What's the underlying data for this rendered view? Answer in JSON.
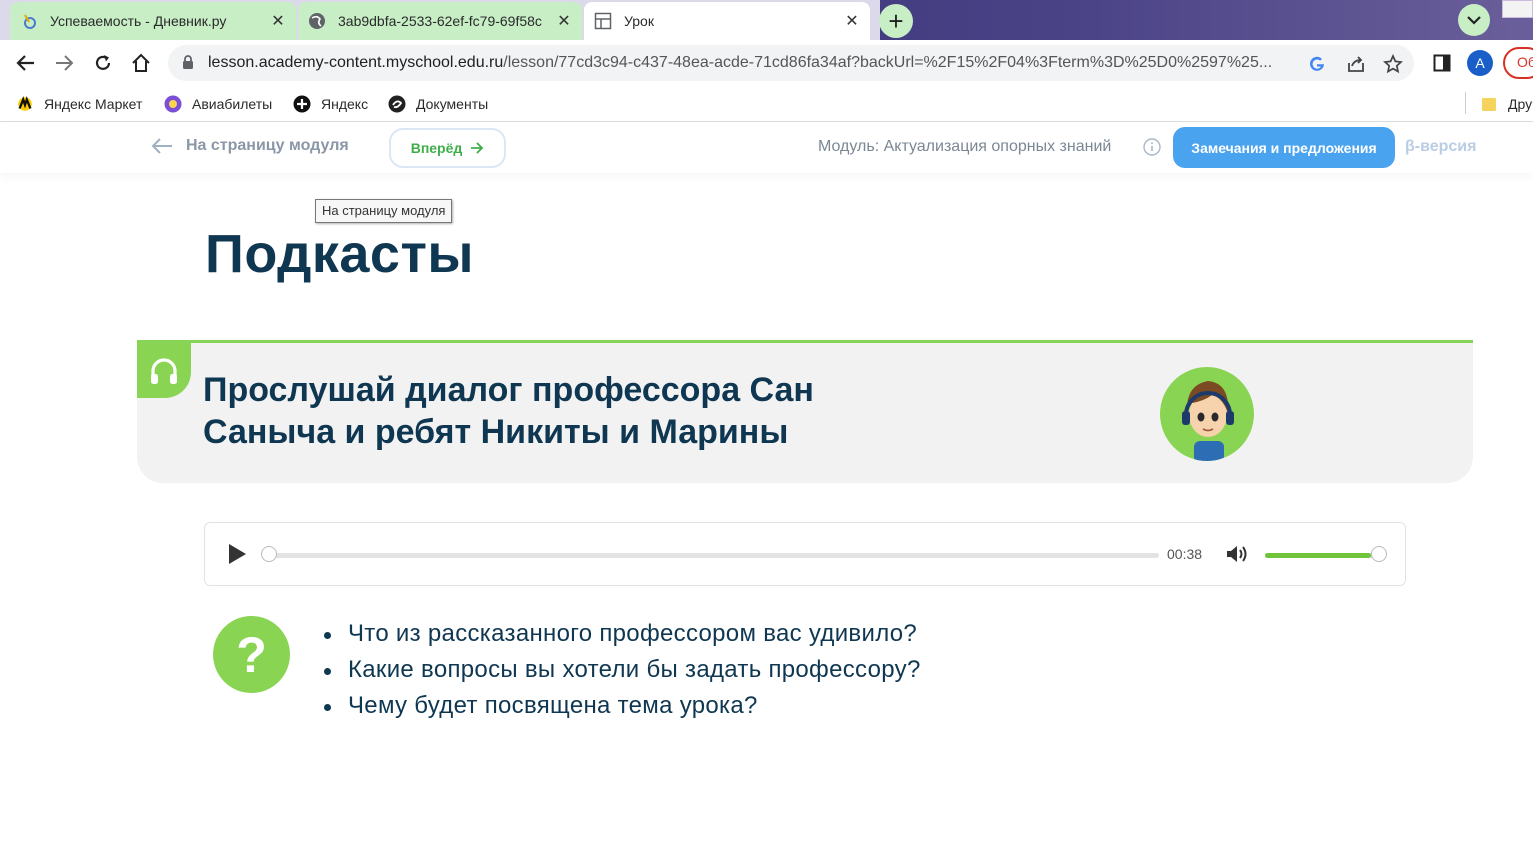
{
  "browser": {
    "tabs": [
      {
        "title": "Успеваемость - Дневник.ру",
        "icon": "dnevnik-favicon-icon",
        "state": "inactive"
      },
      {
        "title": "3ab9dbfa-2533-62ef-fc79-69f58c",
        "icon": "globe-icon",
        "state": "inactive"
      },
      {
        "title": "Урок",
        "icon": "page-layout-icon",
        "state": "active"
      }
    ],
    "url_host": "lesson.academy-content.myschool.edu.ru",
    "url_path": "/lesson/77cd3c94-c437-48ea-acde-71cd86fa34af?backUrl=%2F15%2F04%3Fterm%3D%25D0%2597%25...",
    "avatar_letter": "A",
    "profile_pill": "Об",
    "bookmarks": [
      {
        "label": "Яндекс Маркет",
        "icon": "yandex-market-icon"
      },
      {
        "label": "Авиабилеты",
        "icon": "flights-icon"
      },
      {
        "label": "Яндекс",
        "icon": "yandex-icon"
      },
      {
        "label": "Документы",
        "icon": "documents-icon"
      }
    ],
    "other_bookmarks": "Дру"
  },
  "lesson_nav": {
    "back_label": "На страницу модуля",
    "forward_label": "Вперёд",
    "module_label": "Модуль: Актуализация опорных знаний",
    "feedback_label": "Замечания и предложения",
    "beta_label": "β-версия",
    "tooltip": "На страницу модуля"
  },
  "page": {
    "title": "Подкасты"
  },
  "podcast_card": {
    "title": "Прослушай диалог профессора Сан Саныча и ребят Никиты и Марины"
  },
  "audio_player": {
    "duration": "00:38",
    "progress": 0,
    "volume": 0.95
  },
  "questions": [
    "Что из рассказанного профессором вас удивило?",
    "Какие вопросы вы хотели бы задать профессору?",
    "Чему будет посвящена тема урока?"
  ],
  "colors": {
    "accent_green": "#8ad454",
    "title_navy": "#0f3752",
    "feedback_blue": "#4aa3ef",
    "tab_green": "#c7eec5"
  }
}
